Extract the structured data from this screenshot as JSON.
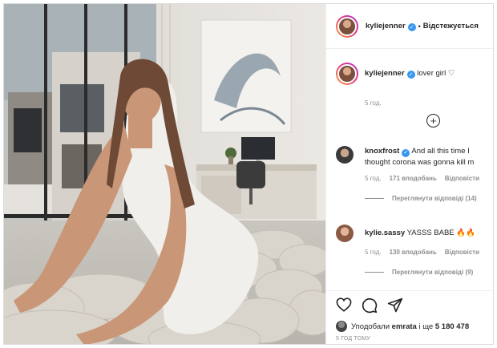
{
  "post": {
    "username": "kyliejenner",
    "follow_label": "Відстежується",
    "caption": "lover girl",
    "caption_emoji": "♡",
    "caption_time": "5 год.",
    "likes_prefix": "Уподобали",
    "likes_user": "emrata",
    "likes_middle": "і ще",
    "likes_count": "5 180 478",
    "posted_ago": "5 ГОД ТОМУ"
  },
  "comments": [
    {
      "username": "knoxfrost",
      "verified": true,
      "text": "And all this time I thought corona was gonna kill m",
      "time": "5 год.",
      "likes": "171 вподобань",
      "reply": "Відповісти",
      "view_replies": "Переглянути відповіді (14)"
    },
    {
      "username": "kylie.sassy",
      "verified": false,
      "text": "YASSS BABE 🔥🔥",
      "time": "5 год.",
      "likes": "130 вподобань",
      "reply": "Відповісти",
      "view_replies": "Переглянути відповіді (9)"
    }
  ],
  "icons": {
    "verified": "✓",
    "plus": "+",
    "like": "heart-icon",
    "comment": "comment-icon",
    "share": "share-icon"
  },
  "colors": {
    "verified": "#3897f0",
    "muted": "#8e8e8e",
    "text": "#262626",
    "story_ring": "#e6407a"
  }
}
